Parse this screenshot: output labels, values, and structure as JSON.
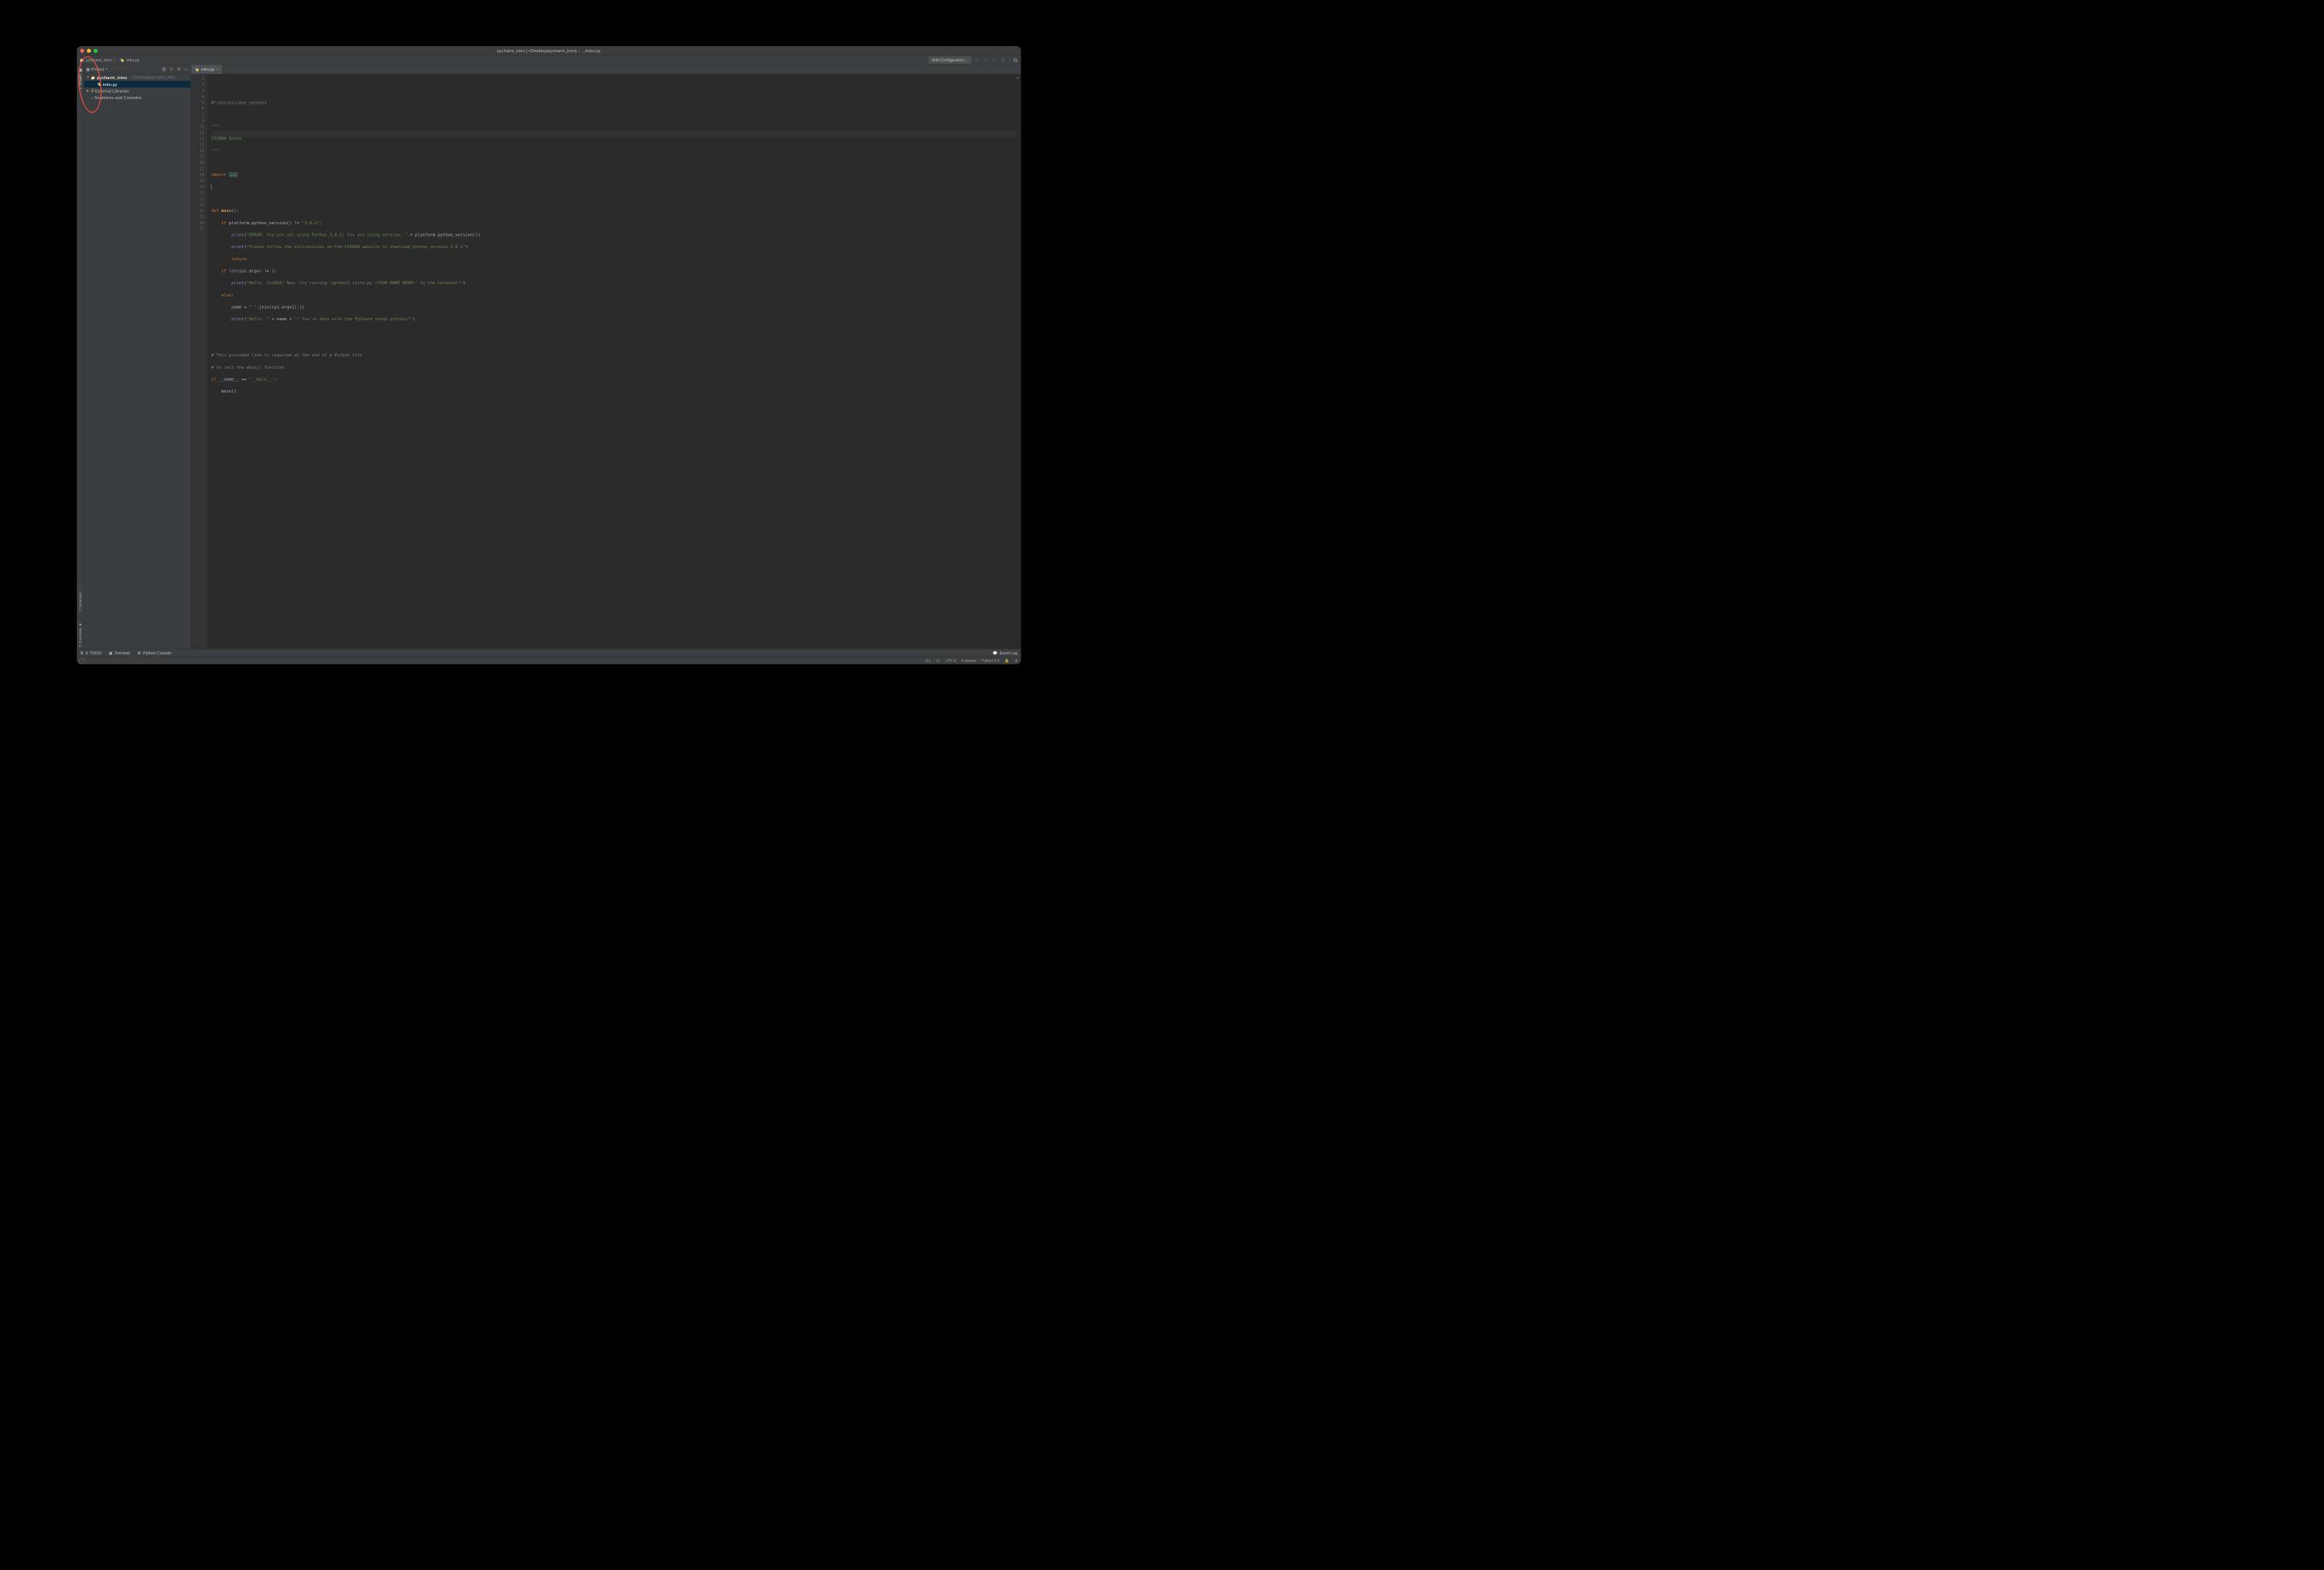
{
  "titlebar": {
    "title": "pycharm_intro [~/Desktop/pycharm_intro] – .../intro.py"
  },
  "breadcrumb": {
    "root": "pycharm_intro",
    "file": "intro.py"
  },
  "toolbar": {
    "add_config": "Add Configuration..."
  },
  "left_tabs": {
    "project": "1: Project",
    "structure": "7: Structure",
    "favorites": "2: Favorites"
  },
  "sidebar": {
    "header_label": "Project",
    "tree": {
      "root_name": "pycharm_intro",
      "root_path": "~/Desktop/pycharm_intro",
      "file_name": "intro.py",
      "external": "External Libraries",
      "scratches": "Scratches and Consoles"
    }
  },
  "tabs": {
    "file": "intro.py"
  },
  "code": {
    "line_numbers": [
      "1",
      "2",
      "3",
      "4",
      "5",
      "6",
      "7",
      "9",
      "10",
      "11",
      "12",
      "13",
      "14",
      "15",
      "16",
      "17",
      "18",
      "19",
      "20",
      "21",
      "22",
      "23",
      "24",
      "25",
      "26",
      "27"
    ],
    "l1": "#!/usr/bin/env python3",
    "l3a": "\"\"\"",
    "l4": "CS106A Intro",
    "l5a": "\"\"\"",
    "l7_kw": "import",
    "l7_ell": "...",
    "l11_def": "def ",
    "l11_fn": "main",
    "l11_rest": "():",
    "l12_if": "if",
    "l12_cond": " platform.python_version() != ",
    "l12_str": "\"3.8.1\"",
    "l12_colon": ":",
    "l13_print": "print",
    "l13_paren": "(",
    "l13_str": "\"ERROR: You are not using Python 3.8.1! You are using version: \"",
    "l13_plus": " + platform.python_version())",
    "l14_print": "print",
    "l14_paren": "(",
    "l14_str": "\"Please follow the instructions on the CS106A website to download python version 3.8.1\"",
    "l14_close": ")",
    "l15_return": "return",
    "l16_if": "if",
    "l16_a": " ",
    "l16_len": "len",
    "l16_b": "(sys.argv) != ",
    "l16_num": "2",
    "l16_colon": ":",
    "l17_print": "print",
    "l17_paren": "(",
    "l17_str": "\"Hello, CS106A! Now, try running 'python3 intro.py <YOUR NAME HERE>' in the terminal!\"",
    "l17_close": ")",
    "l18_else": "else",
    "l18_colon": ":",
    "l19_a": "name = ",
    "l19_str": "\" \"",
    "l19_b": ".join(sys.argv[",
    "l19_num": "1",
    "l19_c": ":])",
    "l20_print": "print",
    "l20_paren": "(",
    "l20_str1": "\"Hello, \"",
    "l20_plus1": " + name + ",
    "l20_str2": "\"! You're done with the PyCharm setup process!\"",
    "l20_close": ")",
    "l23": "# This provided line is required at the end of a Python file",
    "l24": "# to call the main() function.",
    "l25_if": "if",
    "l25_a": " __name__ == ",
    "l25_str": "'__main__'",
    "l25_colon": ":",
    "l26": "main()"
  },
  "bottom": {
    "todo": "6: TODO",
    "terminal": "Terminal",
    "python_console": "Python Console",
    "event_log": "Event Log"
  },
  "status": {
    "pos": "9:1",
    "line_sep": "LF",
    "encoding": "UTF-8",
    "indent": "4 spaces",
    "interpreter": "Python 3.8"
  }
}
